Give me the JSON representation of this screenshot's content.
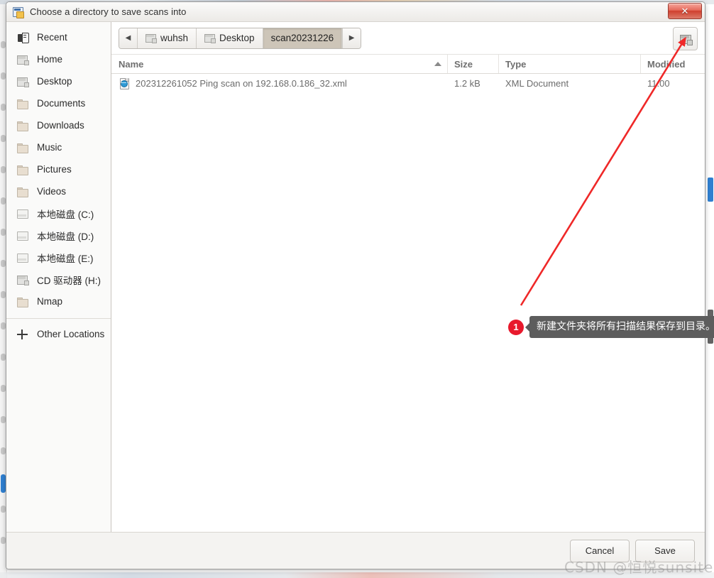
{
  "window": {
    "title": "Choose a directory to save scans into",
    "title_icon": "file-chooser-icon",
    "close_label": "✕"
  },
  "sidebar": {
    "items": [
      {
        "label": "Recent",
        "icon": "recent-icon"
      },
      {
        "label": "Home",
        "icon": "home-icon"
      },
      {
        "label": "Desktop",
        "icon": "desktop-icon"
      },
      {
        "label": "Documents",
        "icon": "folder-icon"
      },
      {
        "label": "Downloads",
        "icon": "folder-icon"
      },
      {
        "label": "Music",
        "icon": "folder-icon"
      },
      {
        "label": "Pictures",
        "icon": "folder-icon"
      },
      {
        "label": "Videos",
        "icon": "folder-icon"
      },
      {
        "label": "本地磁盘 (C:)",
        "icon": "drive-icon"
      },
      {
        "label": "本地磁盘 (D:)",
        "icon": "drive-icon"
      },
      {
        "label": "本地磁盘 (E:)",
        "icon": "drive-icon"
      },
      {
        "label": "CD 驱动器 (H:)",
        "icon": "cd-drive-icon"
      },
      {
        "label": "Nmap",
        "icon": "folder-icon"
      }
    ],
    "other_locations": {
      "label": "Other Locations",
      "icon": "plus-icon"
    }
  },
  "pathbar": {
    "prev_arrow": "◀",
    "next_arrow": "▶",
    "crumbs": [
      {
        "label": "wuhsh",
        "active": false
      },
      {
        "label": "Desktop",
        "active": false
      },
      {
        "label": "scan20231226",
        "active": true
      }
    ],
    "new_folder_button": "create-folder-icon"
  },
  "file_list": {
    "columns": [
      "Name",
      "Size",
      "Type",
      "Modified"
    ],
    "sort_column": "Name",
    "sort_direction": "ascending",
    "rows": [
      {
        "name": "202312261052 Ping scan on 192.168.0.186_32.xml",
        "size": "1.2 kB",
        "type": "XML Document",
        "modified": "11:00",
        "icon": "xml-document-icon"
      }
    ]
  },
  "actions": {
    "cancel_label": "Cancel",
    "save_label": "Save"
  },
  "annotation": {
    "badge": "1",
    "tooltip": "新建文件夹将所有扫描结果保存到目录。",
    "arrow_color": "#ef2828",
    "badge_color": "#e8192c"
  },
  "watermark": {
    "text": "CSDN @恒悦sunsite"
  }
}
